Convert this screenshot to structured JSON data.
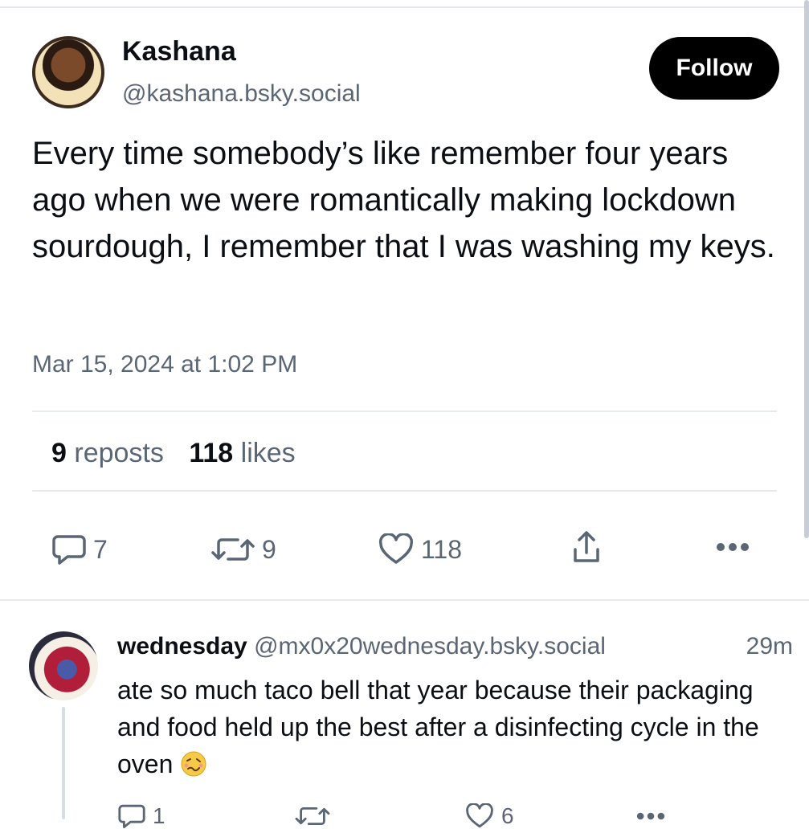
{
  "post": {
    "author_name": "Kashana",
    "author_handle": "@kashana.bsky.social",
    "follow_label": "Follow",
    "text": "Every time somebody’s like remember four years ago when we were romantically making lockdown sourdough, I remember that I was washing my keys.",
    "timestamp": "Mar 15, 2024 at 1:02 PM",
    "stats": {
      "reposts_count": "9",
      "reposts_label": "reposts",
      "likes_count": "118",
      "likes_label": "likes"
    },
    "actions": {
      "reply_count": "7",
      "repost_count": "9",
      "like_count": "118"
    }
  },
  "reply": {
    "author_name": "wednesday",
    "author_handle": "@mx0x20wednesday.bsky.social",
    "time_ago": "29m",
    "text": "ate so much taco bell that year because their packaging and food held up the best after a disinfecting cycle in the oven",
    "emoji": "woozy-face",
    "actions": {
      "reply_count": "1",
      "like_count": "6"
    }
  },
  "icons": {
    "reply": "reply-icon",
    "repost": "repost-icon",
    "like": "heart-icon",
    "share": "share-icon",
    "more": "more-icon"
  },
  "colors": {
    "muted": "#5b6675",
    "text": "#0b0f14",
    "follow_bg": "#000000"
  }
}
